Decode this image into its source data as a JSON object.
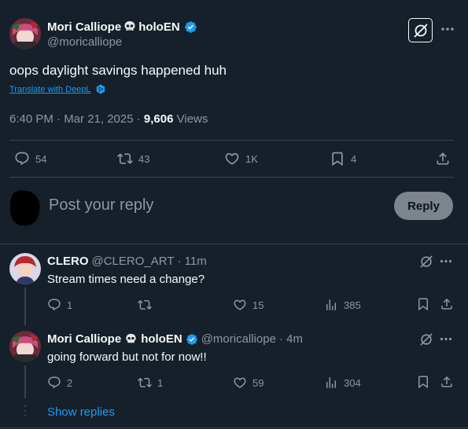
{
  "main_tweet": {
    "display_name": "Mori Calliope",
    "name_suffix": "holoEN",
    "handle": "@moricalliope",
    "text": "oops daylight savings happened huh",
    "translate_label": "Translate with DeepL",
    "timestamp": "6:40 PM · Mar 21, 2025 · ",
    "views_count": "9,606",
    "views_label": " Views",
    "stats": {
      "replies": "54",
      "reposts": "43",
      "likes": "1K",
      "bookmarks": "4"
    }
  },
  "composer": {
    "placeholder": "Post your reply",
    "reply_button": "Reply"
  },
  "replies": [
    {
      "display_name": "CLERO",
      "handle": "@CLERO_ART",
      "time": "· 11m",
      "text": "Stream times need a change?",
      "replies": "1",
      "reposts": "",
      "likes": "15",
      "views": "385"
    },
    {
      "display_name": "Mori Calliope",
      "name_suffix": "holoEN",
      "handle": "@moricalliope",
      "time": "· 4m",
      "text": "going forward but not for now!!",
      "replies": "2",
      "reposts": "1",
      "likes": "59",
      "views": "304"
    }
  ],
  "show_replies_label": "Show replies",
  "colors": {
    "background": "#15202b",
    "accent": "#1d9bf0",
    "muted": "#8b98a5",
    "divider": "#38444d"
  }
}
